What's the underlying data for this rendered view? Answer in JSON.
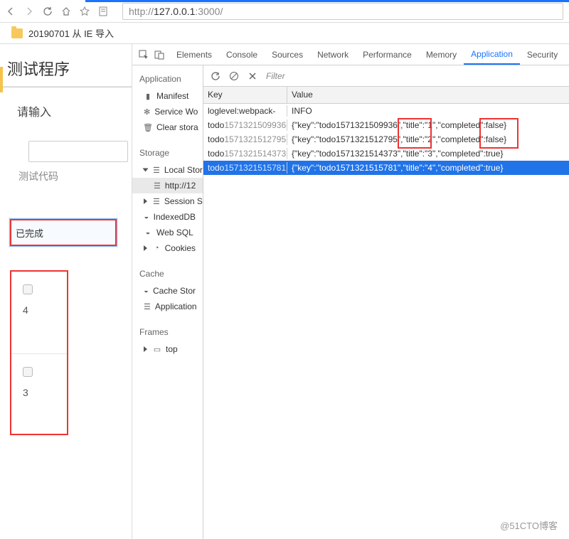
{
  "browser": {
    "url_prefix": "http://",
    "url_host": "127.0.0.1",
    "url_port": ":3000/",
    "bookmark": "20190701 从 IE 导入"
  },
  "page": {
    "title": "测试程序",
    "input_label": "请输入",
    "code_label": "测试代码",
    "completed_label": "已完成",
    "items": [
      "4",
      "3"
    ]
  },
  "devtools": {
    "tabs": [
      "Elements",
      "Console",
      "Sources",
      "Network",
      "Performance",
      "Memory",
      "Application",
      "Security"
    ],
    "active_tab": "Application",
    "filter_placeholder": "Filter",
    "sidebar": {
      "application": {
        "head": "Application",
        "items": [
          "Manifest",
          "Service Wo",
          "Clear stora"
        ]
      },
      "storage": {
        "head": "Storage",
        "items": [
          "Local Stora",
          "http://12",
          "Session Sto",
          "IndexedDB",
          "Web SQL",
          "Cookies"
        ]
      },
      "cache": {
        "head": "Cache",
        "items": [
          "Cache Stor",
          "Application"
        ]
      },
      "frames": {
        "head": "Frames",
        "items": [
          "top"
        ]
      }
    },
    "table": {
      "head_key": "Key",
      "head_value": "Value",
      "rows": [
        {
          "key_prefix": "loglevel:webpack-",
          "key_suffix": "",
          "value": "INFO"
        },
        {
          "key_prefix": "todo",
          "key_suffix": "1571321509936",
          "value": "{\"key\":\"todo1571321509936\",\"title\":\"1\",\"completed\":false}"
        },
        {
          "key_prefix": "todo",
          "key_suffix": "1571321512795",
          "value": "{\"key\":\"todo1571321512795\",\"title\":\"2\",\"completed\":false}"
        },
        {
          "key_prefix": "todo",
          "key_suffix": "1571321514373",
          "value": "{\"key\":\"todo1571321514373\",\"title\":\"3\",\"completed\":true}"
        },
        {
          "key_prefix": "todo",
          "key_suffix": "1571321515781",
          "value": "{\"key\":\"todo1571321515781\",\"title\":\"4\",\"completed\":true}"
        }
      ],
      "selected_index": 4
    }
  },
  "watermark": "@51CTO博客"
}
